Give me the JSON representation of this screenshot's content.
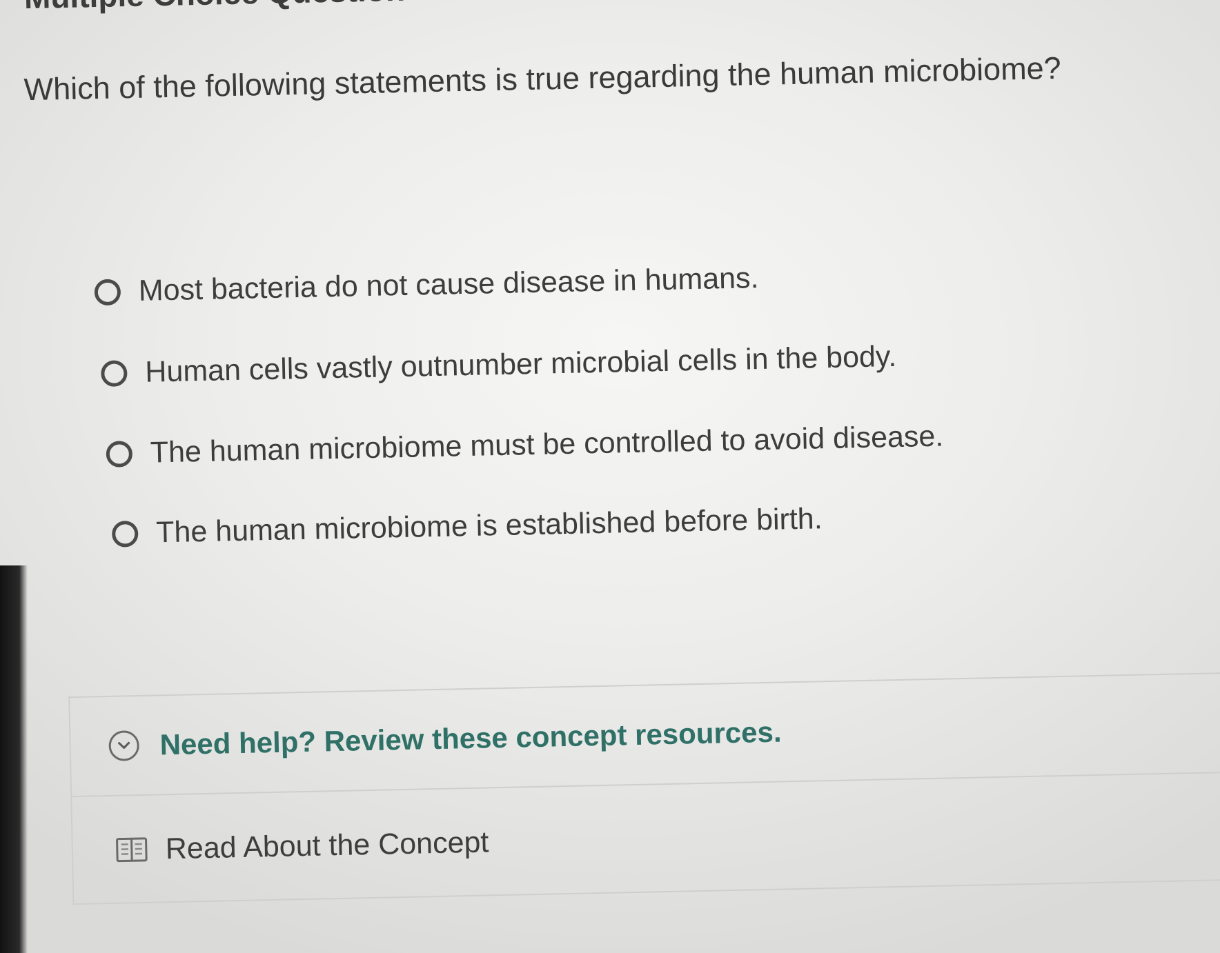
{
  "header": {
    "question_type": "Multiple Choice Question"
  },
  "question": {
    "text": "Which of the following statements is true regarding the human microbiome?"
  },
  "options": [
    {
      "label": "Most bacteria do not cause disease in humans.",
      "selected": false
    },
    {
      "label": "Human cells vastly outnumber microbial cells in the body.",
      "selected": false
    },
    {
      "label": "The human microbiome must be controlled to avoid disease.",
      "selected": false
    },
    {
      "label": "The human microbiome is established before birth.",
      "selected": false
    }
  ],
  "help": {
    "title": "Need help? Review these concept resources.",
    "toggle_icon": "chevron-down-icon",
    "resources": [
      {
        "label": "Read About the Concept",
        "icon": "book-icon"
      }
    ]
  },
  "colors": {
    "help_title": "#2f7067",
    "text": "#3d3d3d",
    "radio_border": "#4b4b4b"
  }
}
